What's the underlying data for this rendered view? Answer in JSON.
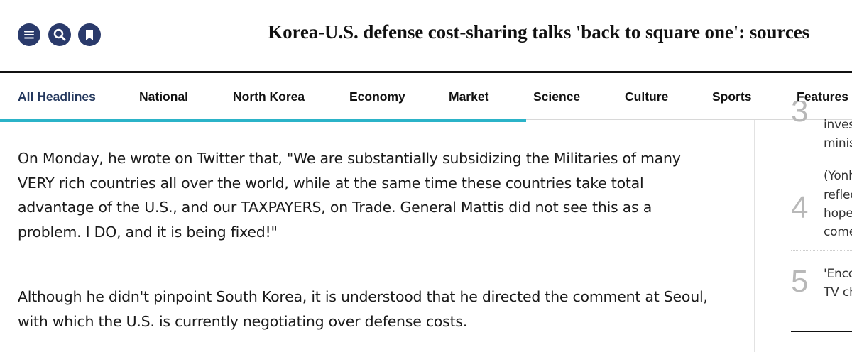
{
  "header": {
    "title": "Korea-U.S. defense cost-sharing talks 'back to square one': sources",
    "menu_icon": "menu-icon",
    "search_icon": "search-icon",
    "bookmark_icon": "bookmark-icon",
    "icon_color": "#2a3a6b"
  },
  "nav": {
    "items": [
      {
        "label": "All Headlines",
        "active": true
      },
      {
        "label": "National"
      },
      {
        "label": "North Korea"
      },
      {
        "label": "Economy"
      },
      {
        "label": "Market"
      },
      {
        "label": "Science"
      },
      {
        "label": "Culture"
      },
      {
        "label": "Sports"
      },
      {
        "label": "Features"
      }
    ],
    "active_color": "#24385e",
    "accent_color": "#2bb3c8"
  },
  "article": {
    "paragraphs": [
      {
        "lines": [
          "On Monday, he wrote on Twitter that, \"We are substantially subsidizing the Militaries of many",
          "VERY rich countries all over the world, while at the same time these countries take total",
          "advantage of the U.S., and our TAXPAYERS, on Trade. General Mattis did not see this as a",
          "problem. I DO, and it is being fixed!\""
        ]
      },
      {
        "lines": [
          "Although he didn't pinpoint South Korea, it is understood that he directed the comment at Seoul,",
          "with which the U.S. is currently negotiating over defense costs."
        ]
      }
    ]
  },
  "sidebar": {
    "items": [
      {
        "rank": "3",
        "lines": [
          "inves",
          "minis"
        ]
      },
      {
        "rank": "4",
        "lines": [
          "(Yonh",
          "reflec",
          "hope",
          "come"
        ]
      },
      {
        "rank": "5",
        "lines": [
          "'Enco",
          "TV ch"
        ]
      }
    ]
  }
}
